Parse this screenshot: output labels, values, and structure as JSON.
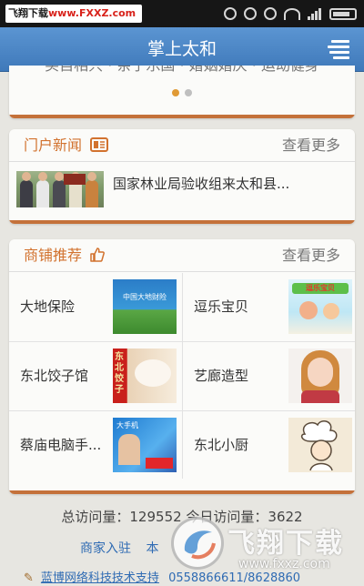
{
  "status_bar": {
    "watermark_black": "飞翔下载",
    "watermark_red": "www.FXXZ.com"
  },
  "header": {
    "title": "掌上太和"
  },
  "banner": {
    "caption_cut": "买自相只 · 亲子乐国 · 婚姻婚庆 · 运动健身"
  },
  "news_section": {
    "title": "门户新闻",
    "more": "查看更多",
    "items": [
      {
        "title": "国家林业局验收组来太和县..."
      }
    ]
  },
  "shop_section": {
    "title": "商铺推荐",
    "more": "查看更多",
    "items": [
      {
        "name": "大地保险",
        "image_text": "中国大地财险"
      },
      {
        "name": "逗乐宝贝",
        "image_text": "逗乐宝贝"
      },
      {
        "name": "东北饺子馆",
        "image_text": "东北饺子"
      },
      {
        "name": "艺廊造型",
        "image_text": ""
      },
      {
        "name": "蔡庙电脑手...",
        "image_text": "大手机"
      },
      {
        "name": "东北小厨",
        "image_text": ""
      }
    ]
  },
  "footer": {
    "stats": "总访问量：129552  今日访问量：3622",
    "links": [
      "商家入驻",
      "本"
    ],
    "support": "蓝博网络科技技术支持",
    "phone": "0558866611/8628860"
  },
  "watermark": {
    "title": "飞翔下载",
    "url": "www.fxxz.com"
  },
  "colors": {
    "accent": "#d2722e",
    "appbar": "#4a86c6",
    "link": "#2f6bb3"
  }
}
